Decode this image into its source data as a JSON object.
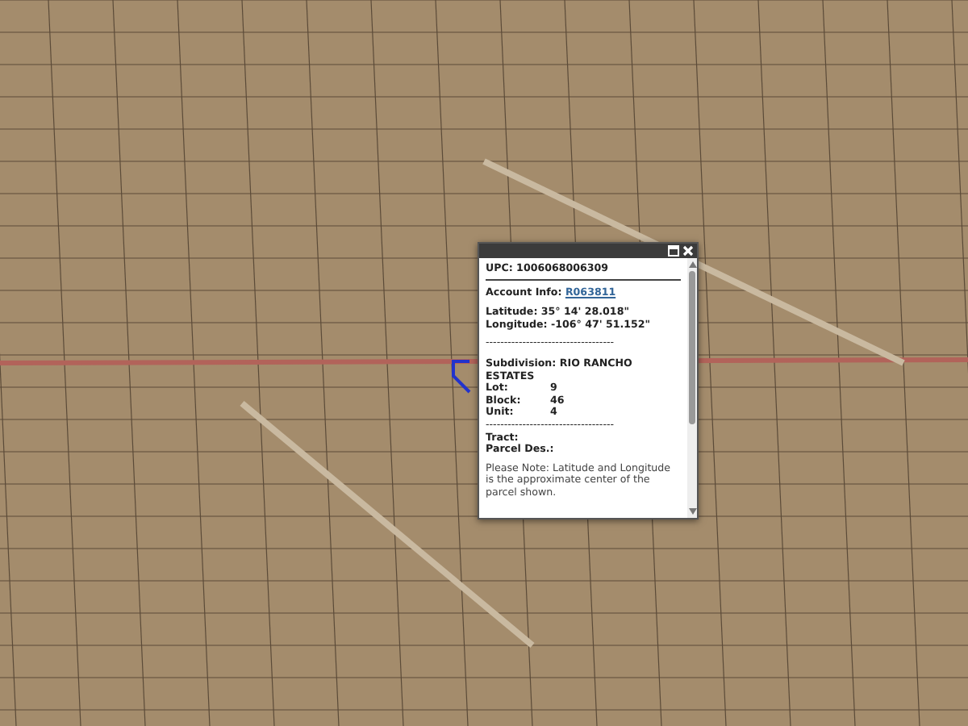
{
  "popup": {
    "upc": "UPC: 1006068006309",
    "account_label": "Account Info:",
    "account_link": "R063811",
    "latitude": "Latitude: 35° 14' 28.018\"",
    "longitude": "Longitude: -106° 47' 51.152\"",
    "separator": "-----------------------------------",
    "subdivision": "Subdivision: RIO RANCHO ESTATES",
    "fields": [
      {
        "label": "Lot:",
        "value": "9"
      },
      {
        "label": "Block:",
        "value": "46"
      },
      {
        "label": "Unit:",
        "value": "4"
      }
    ],
    "separator_2": "-----------------------------------",
    "tract": "Tract:",
    "parcel": "Parcel Des.:",
    "note": "Please Note: Latitude and Longitude is the approximate center of the parcel shown."
  }
}
